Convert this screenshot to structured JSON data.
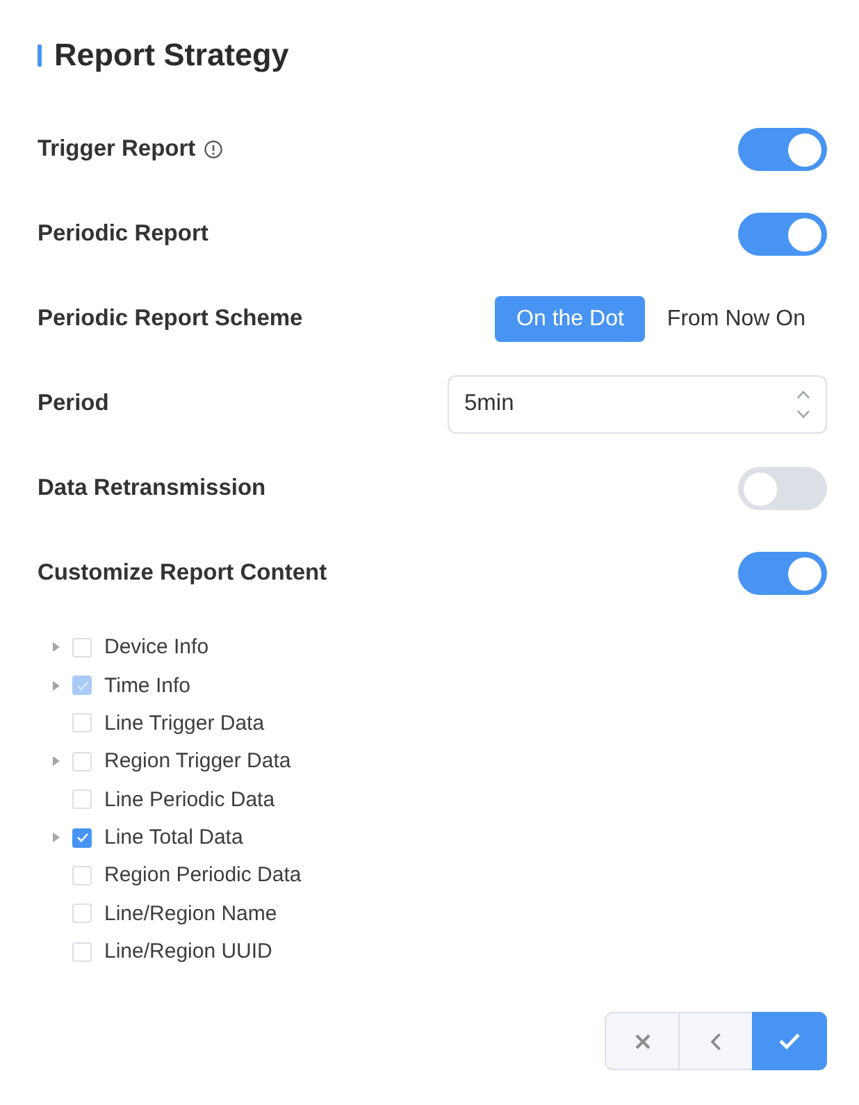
{
  "header": {
    "title": "Report Strategy"
  },
  "settings": [
    {
      "kind": "toggle",
      "label": "Trigger Report",
      "info": true,
      "on": true
    },
    {
      "kind": "toggle",
      "label": "Periodic Report",
      "info": false,
      "on": true
    },
    {
      "kind": "segmented",
      "label": "Periodic Report Scheme",
      "options": [
        {
          "label": "On the Dot",
          "selected": true
        },
        {
          "label": "From Now On",
          "selected": false
        }
      ]
    },
    {
      "kind": "number",
      "label": "Period",
      "value": "5min"
    },
    {
      "kind": "toggle",
      "label": "Data Retransmission",
      "info": false,
      "on": false
    },
    {
      "kind": "toggle",
      "label": "Customize Report Content",
      "info": false,
      "on": true
    }
  ],
  "report_content": {
    "items": [
      {
        "label": "Device Info",
        "kind": "branch",
        "checked": false,
        "disabled": false
      },
      {
        "label": "Time Info",
        "kind": "branch",
        "checked": true,
        "disabled": true
      },
      {
        "label": "Line Trigger Data",
        "kind": "leaf",
        "checked": false,
        "disabled": false
      },
      {
        "label": "Region Trigger Data",
        "kind": "branch",
        "checked": false,
        "disabled": false
      },
      {
        "label": "Line Periodic Data",
        "kind": "leaf",
        "checked": false,
        "disabled": false
      },
      {
        "label": "Line Total Data",
        "kind": "branch",
        "checked": true,
        "disabled": false
      },
      {
        "label": "Region Periodic Data",
        "kind": "leaf",
        "checked": false,
        "disabled": false
      },
      {
        "label": "Line/Region Name",
        "kind": "leaf",
        "checked": false,
        "disabled": false
      },
      {
        "label": "Line/Region UUID",
        "kind": "leaf",
        "checked": false,
        "disabled": false
      }
    ]
  },
  "actions": [
    {
      "kind": "cancel"
    },
    {
      "kind": "back"
    },
    {
      "kind": "confirm"
    }
  ]
}
